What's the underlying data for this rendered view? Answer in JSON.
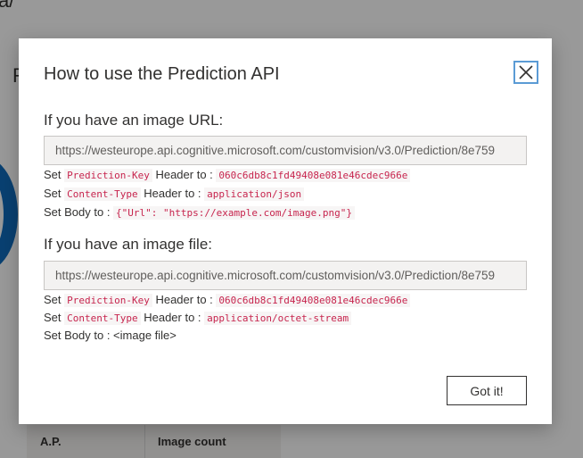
{
  "background": {
    "title_fragment": "a/",
    "side_letter": "R",
    "table_headers": [
      "A.P.",
      "Image count"
    ]
  },
  "dialog": {
    "title": "How to use the Prediction API",
    "close_icon": "close-icon",
    "url_section": {
      "heading": "If you have an image URL:",
      "endpoint": "https://westeurope.api.cognitive.microsoft.com/customvision/v3.0/Prediction/8e759",
      "lines": [
        {
          "prefix": "Set ",
          "code": "Prediction-Key",
          "middle": " Header to : ",
          "value": "060c6db8c1fd49408e081e46cdec966e"
        },
        {
          "prefix": "Set ",
          "code": "Content-Type",
          "middle": " Header to : ",
          "value": "application/json"
        },
        {
          "prefix": "Set Body to : ",
          "value": "{\"Url\": \"https://example.com/image.png\"}"
        }
      ]
    },
    "file_section": {
      "heading": "If you have an image file:",
      "endpoint": "https://westeurope.api.cognitive.microsoft.com/customvision/v3.0/Prediction/8e759",
      "lines": [
        {
          "prefix": "Set ",
          "code": "Prediction-Key",
          "middle": " Header to : ",
          "value": "060c6db8c1fd49408e081e46cdec966e"
        },
        {
          "prefix": "Set ",
          "code": "Content-Type",
          "middle": " Header to : ",
          "value": "application/octet-stream"
        },
        {
          "prefix": "Set Body to : ",
          "text": "<image file>"
        }
      ]
    },
    "got_it_label": "Got it!"
  },
  "colors": {
    "code_text": "#c7254e",
    "focus_border": "#5b9bd5",
    "accent_ring": "#0f6cbd"
  }
}
